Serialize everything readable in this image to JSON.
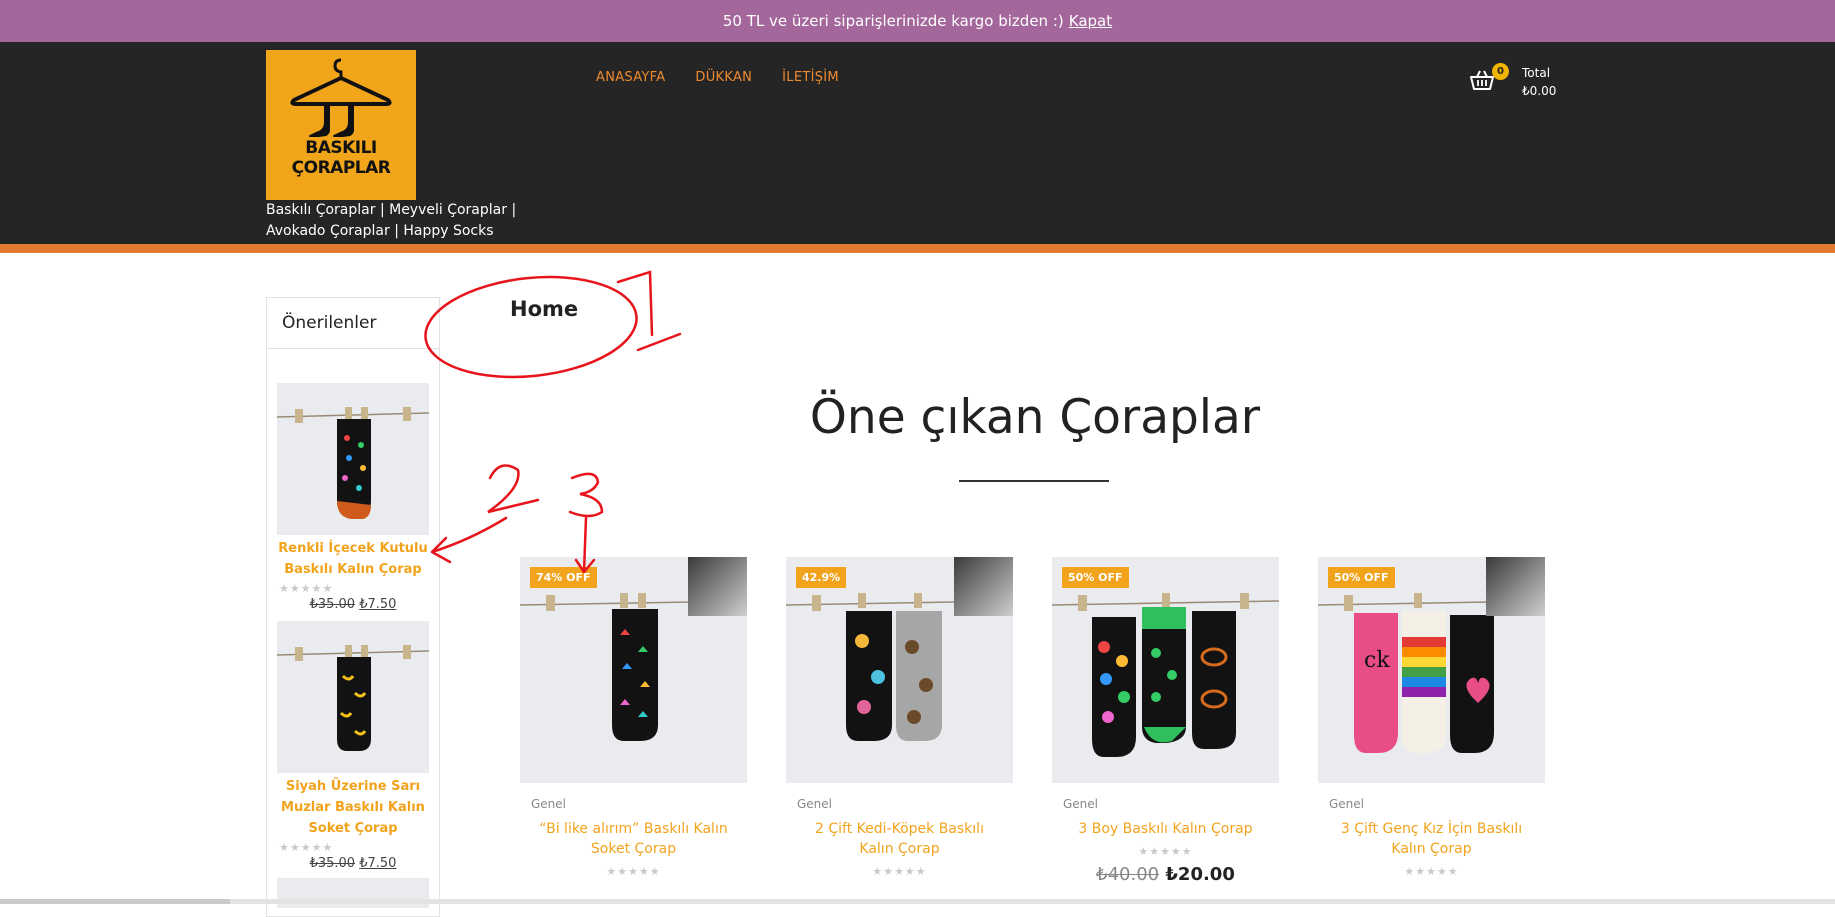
{
  "topbar": {
    "message": "50 TL ve üzeri siparişlerinizde kargo bizden :)",
    "close_link": "Kapat"
  },
  "logo": {
    "line1": "BASKILI",
    "line2": "ÇORAPLAR"
  },
  "tagline": "Baskılı Çoraplar | Meyveli Çoraplar | Avokado Çoraplar | Happy Socks",
  "nav": {
    "items": [
      {
        "label": "ANASAYFA"
      },
      {
        "label": "DÜKKAN"
      },
      {
        "label": "İLETİŞİM"
      }
    ]
  },
  "cart": {
    "count": "0",
    "label": "Total",
    "amount": "₺0.00",
    "icon": "basket-icon"
  },
  "sidebar": {
    "title": "Önerilenler",
    "products": [
      {
        "name": "Renkli İçecek Kutulu Baskılı Kalın Çorap",
        "old_price": "₺35.00",
        "new_price": "₺7.50",
        "stars": "★★★★★"
      },
      {
        "name": "Siyah Üzerine Sarı Muzlar Baskılı Kalın Soket Çorap",
        "old_price": "₺35.00",
        "new_price": "₺7.50",
        "stars": "★★★★★"
      }
    ]
  },
  "main": {
    "page_label": "Home",
    "section_title": "Öne çıkan Çoraplar",
    "products": [
      {
        "badge": "74% OFF",
        "category": "Genel",
        "name": "“Bi like alırım” Baskılı Kalın Soket Çorap",
        "stars": "★★★★★",
        "old_price": "",
        "new_price": ""
      },
      {
        "badge": "42.9%",
        "category": "Genel",
        "name": "2 Çift Kedi-Köpek Baskılı Kalın Çorap",
        "stars": "★★★★★",
        "old_price": "",
        "new_price": ""
      },
      {
        "badge": "50% OFF",
        "category": "Genel",
        "name": "3 Boy Baskılı Kalın Çorap",
        "stars": "★★★★★",
        "old_price": "₺40.00",
        "new_price": "₺20.00"
      },
      {
        "badge": "50% OFF",
        "category": "Genel",
        "name": "3 Çift Genç Kız İçin Baskılı Kalın Çorap",
        "stars": "★★★★★",
        "old_price": "",
        "new_price": ""
      }
    ]
  },
  "annotations": {
    "label1": "1",
    "label2": "2",
    "label3": "3"
  },
  "colors": {
    "topbar": "#a4679b",
    "header": "#252525",
    "accent": "#e07b2f",
    "link": "#f2a31c",
    "nav": "#ee8a2e",
    "annotation": "#e8141b"
  }
}
